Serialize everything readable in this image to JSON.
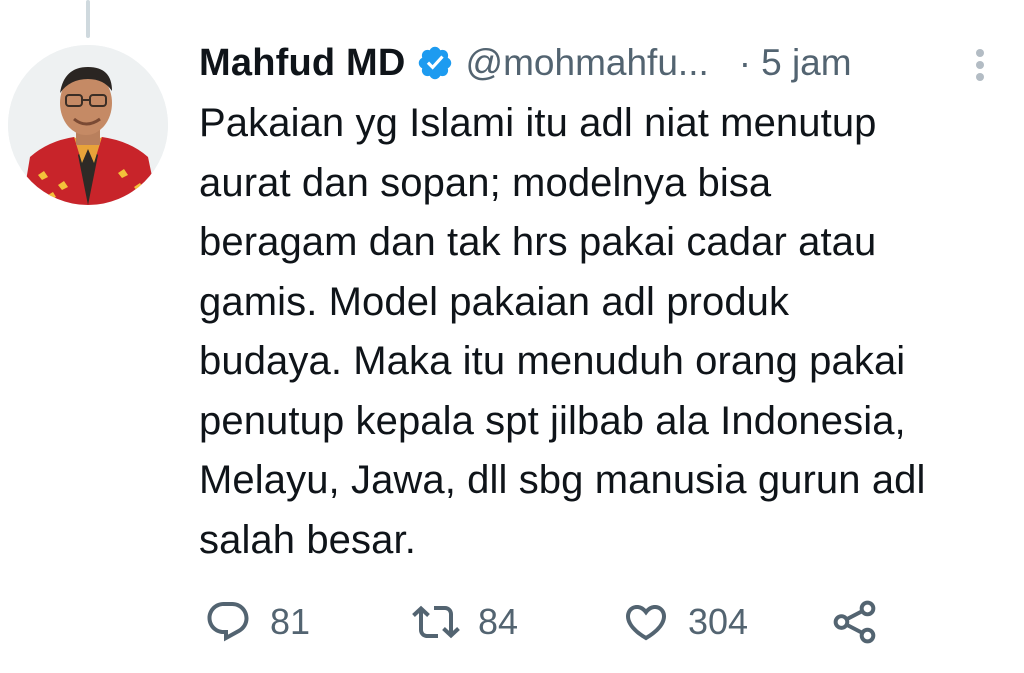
{
  "tweet": {
    "author_name": "Mahfud MD",
    "verified_icon": "verified-badge-icon",
    "handle": "@mohmahfu...",
    "separator": "·",
    "time": "5 jam",
    "text": "Pakaian yg Islami itu adl niat menutup\naurat dan sopan; modelnya bisa\nberagam dan tak hrs pakai cadar atau\ngamis. Model pakaian adl produk\nbudaya. Maka itu menuduh orang pakai\npenutup kepala spt jilbab ala Indonesia,\nMelayu, Jawa, dll sbg manusia gurun adl\nsalah besar."
  },
  "actions": {
    "reply": {
      "icon": "reply-icon",
      "count": "81"
    },
    "retweet": {
      "icon": "retweet-icon",
      "count": "84"
    },
    "like": {
      "icon": "heart-icon",
      "count": "304"
    },
    "share": {
      "icon": "share-icon"
    }
  },
  "colors": {
    "text": "#0f1419",
    "secondary": "#536471",
    "verified": "#1d9bf0",
    "thread_line": "#cfd9de"
  }
}
